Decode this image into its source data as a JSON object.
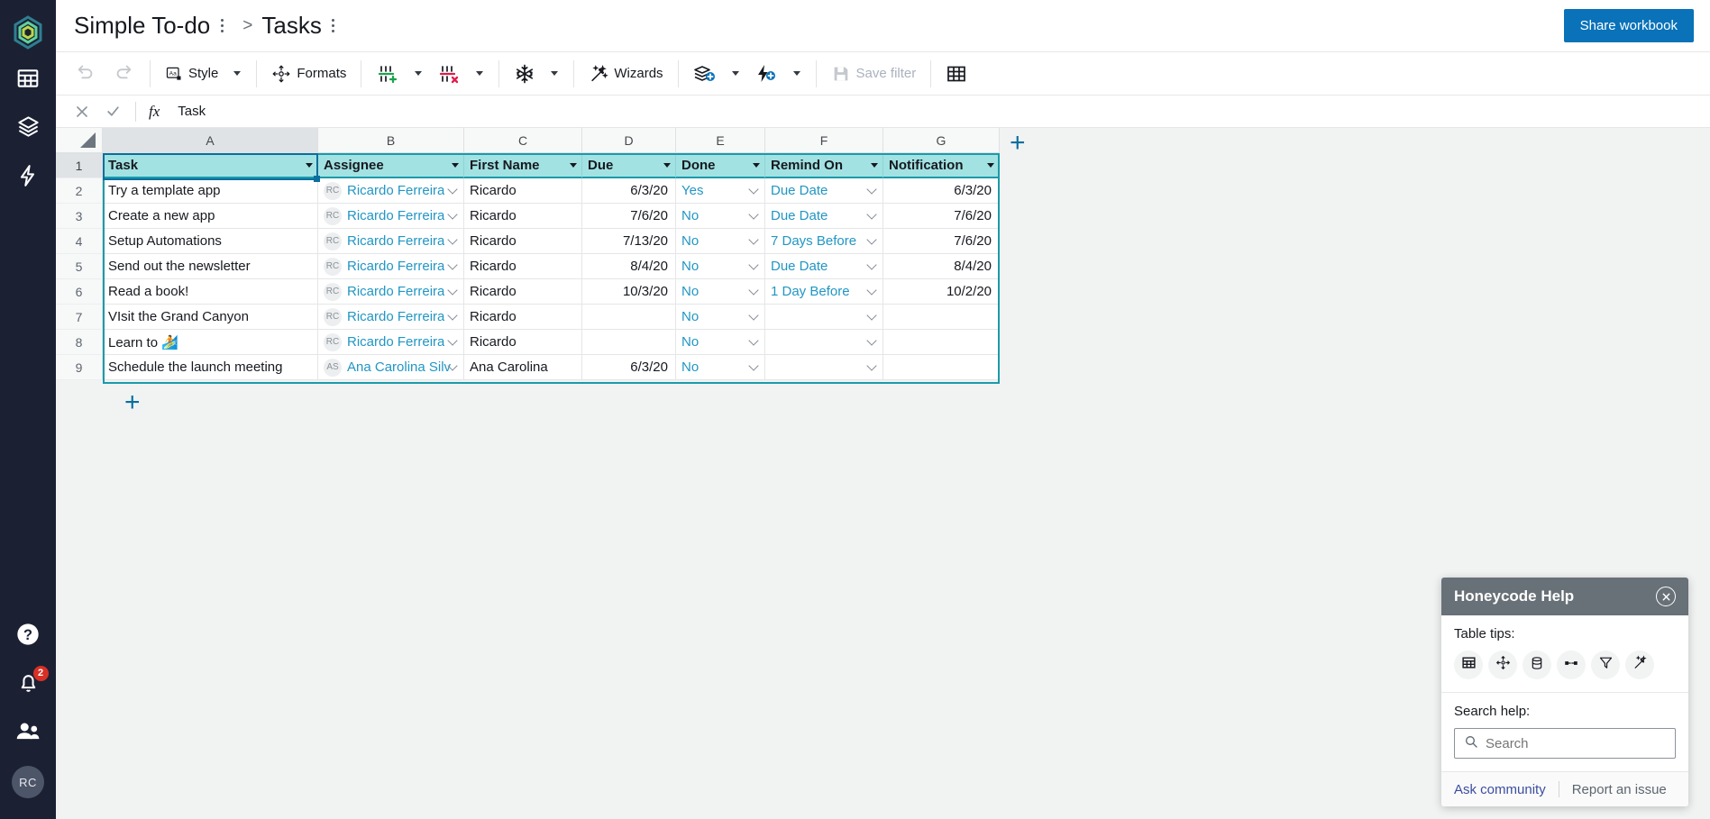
{
  "rail": {
    "logo": "honeycode-logo-icon",
    "items": [
      {
        "name": "tables-icon",
        "label": "Tables"
      },
      {
        "name": "apps-layers-icon",
        "label": "Apps"
      },
      {
        "name": "automations-bolt-icon",
        "label": "Automations"
      }
    ],
    "bottom": [
      {
        "name": "help-circle-icon",
        "label": "Help"
      },
      {
        "name": "notifications-bell-icon",
        "label": "Notifications",
        "badge": "2"
      },
      {
        "name": "team-members-icon",
        "label": "Members"
      }
    ],
    "avatar_initials": "RC"
  },
  "header": {
    "workbook_title": "Simple To-do",
    "separator": ">",
    "sheet_title": "Tasks",
    "share_label": "Share workbook"
  },
  "toolbar": {
    "undo": "undo-arrow",
    "redo": "redo-arrow",
    "style_label": "Style",
    "formats_label": "Formats",
    "insert_rows_label": "Insert rows",
    "delete_rows_label": "Delete rows",
    "freeze_label": "Freeze",
    "wizards_label": "Wizards",
    "add_layers_label": "Add table",
    "add_automation_label": "Add automation",
    "save_filter_label": "Save filter",
    "grid_toggle_label": "Toggle grid"
  },
  "formula_bar": {
    "cancel": "cancel-x",
    "accept": "accept-check",
    "fx": "fx",
    "value": "Task"
  },
  "grid": {
    "column_letters": [
      "A",
      "B",
      "C",
      "D",
      "E",
      "F",
      "G"
    ],
    "selected_column": "A",
    "row_numbers": [
      "1",
      "2",
      "3",
      "4",
      "5",
      "6",
      "7",
      "8",
      "9"
    ],
    "selected_row": "1",
    "add_column_label": "+",
    "add_row_label": "+",
    "headers": [
      "Task",
      "Assignee",
      "First Name",
      "Due",
      "Done",
      "Remind On",
      "Notification"
    ],
    "rows": [
      {
        "task": "Try a template app",
        "assignee_initials": "RC",
        "assignee": "Ricardo Ferreira",
        "first_name": "Ricardo",
        "due": "6/3/20",
        "done": "Yes",
        "remind_on": "Due Date",
        "notification": "6/3/20"
      },
      {
        "task": "Create a new app",
        "assignee_initials": "RC",
        "assignee": "Ricardo Ferreira",
        "first_name": "Ricardo",
        "due": "7/6/20",
        "done": "No",
        "remind_on": "Due Date",
        "notification": "7/6/20"
      },
      {
        "task": "Setup Automations",
        "assignee_initials": "RC",
        "assignee": "Ricardo Ferreira",
        "first_name": "Ricardo",
        "due": "7/13/20",
        "done": "No",
        "remind_on": "7 Days Before",
        "notification": "7/6/20"
      },
      {
        "task": "Send out the newsletter",
        "assignee_initials": "RC",
        "assignee": "Ricardo Ferreira",
        "first_name": "Ricardo",
        "due": "8/4/20",
        "done": "No",
        "remind_on": "Due Date",
        "notification": "8/4/20"
      },
      {
        "task": "Read a book!",
        "assignee_initials": "RC",
        "assignee": "Ricardo Ferreira",
        "first_name": "Ricardo",
        "due": "10/3/20",
        "done": "No",
        "remind_on": "1 Day Before",
        "notification": "10/2/20"
      },
      {
        "task": "VIsit the Grand Canyon",
        "assignee_initials": "RC",
        "assignee": "Ricardo Ferreira",
        "first_name": "Ricardo",
        "due": "",
        "done": "No",
        "remind_on": "",
        "notification": ""
      },
      {
        "task": "Learn to 🏄",
        "assignee_initials": "RC",
        "assignee": "Ricardo Ferreira",
        "first_name": "Ricardo",
        "due": "",
        "done": "No",
        "remind_on": "",
        "notification": ""
      },
      {
        "task": "Schedule the launch meeting",
        "assignee_initials": "AS",
        "assignee": "Ana Carolina Silv",
        "first_name": "Ana Carolina",
        "due": "6/3/20",
        "done": "No",
        "remind_on": "",
        "notification": ""
      }
    ]
  },
  "help_panel": {
    "title": "Honeycode Help",
    "close": "close-icon",
    "table_tips_label": "Table tips:",
    "tips": [
      {
        "name": "table-grid-icon"
      },
      {
        "name": "move-arrows-icon"
      },
      {
        "name": "database-icon"
      },
      {
        "name": "link-icon"
      },
      {
        "name": "filter-funnel-icon"
      },
      {
        "name": "magic-wand-icon"
      }
    ],
    "search_label": "Search help:",
    "search_placeholder": "Search",
    "search_value": "",
    "ask_community": "Ask community",
    "report_issue": "Report an issue"
  },
  "colors": {
    "rail_bg": "#1b2133",
    "accent_blue": "#0972b9",
    "table_header": "#a2e2e2",
    "table_border": "#1b9aaa",
    "link": "#2196c4",
    "badge_red": "#d93025"
  }
}
